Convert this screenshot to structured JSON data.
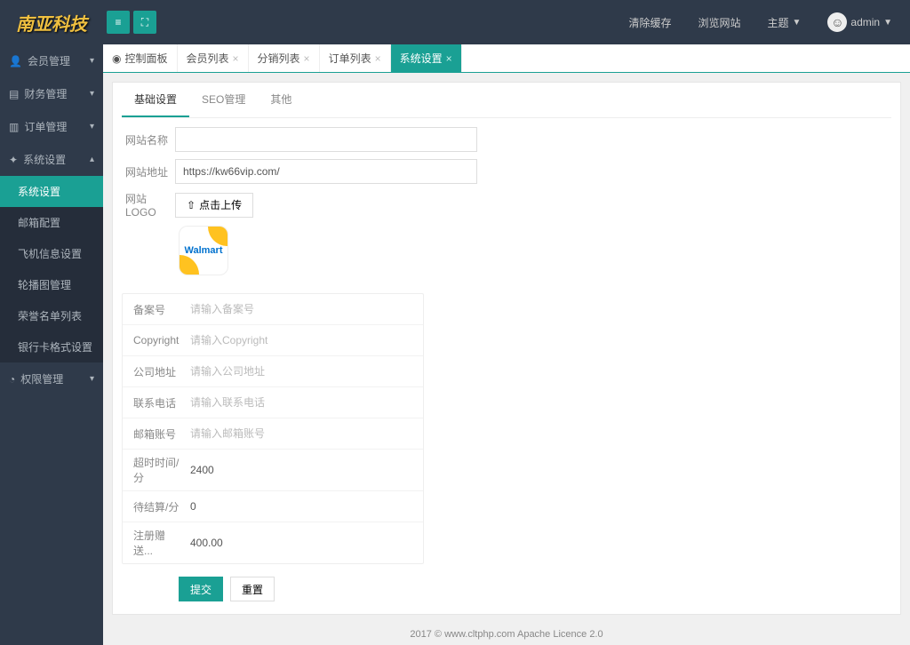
{
  "topbar": {
    "logo_text": "南亚科技",
    "clear_cache": "清除缓存",
    "view_site": "浏览网站",
    "theme": "主题",
    "username": "admin"
  },
  "sidebar": {
    "items": [
      {
        "icon": "👤",
        "label": "会员管理"
      },
      {
        "icon": "📋",
        "label": "财务管理"
      },
      {
        "icon": "📄",
        "label": "订单管理"
      },
      {
        "icon": "🔧",
        "label": "系统设置",
        "expanded": true,
        "children": [
          {
            "label": "系统设置",
            "active": true
          },
          {
            "label": "邮箱配置"
          },
          {
            "label": "飞机信息设置"
          },
          {
            "label": "轮播图管理"
          },
          {
            "label": "荣誉名单列表"
          },
          {
            "label": "银行卡格式设置"
          }
        ]
      },
      {
        "icon": "🔒",
        "label": "权限管理"
      }
    ]
  },
  "tabs": [
    {
      "label": "控制面板",
      "home": true
    },
    {
      "label": "会员列表"
    },
    {
      "label": "分销列表"
    },
    {
      "label": "订单列表"
    },
    {
      "label": "系统设置",
      "active": true
    }
  ],
  "subtabs": [
    {
      "label": "基础设置",
      "active": true
    },
    {
      "label": "SEO管理"
    },
    {
      "label": "其他"
    }
  ],
  "form": {
    "site_name_label": "网站名称",
    "site_name_value": "",
    "site_url_label": "网站地址",
    "site_url_value": "https://kw66vip.com/",
    "site_logo_label": "网站LOGO",
    "upload_btn": "点击上传",
    "logo_preview_text": "Walmart",
    "icp_label": "备案号",
    "icp_placeholder": "请输入备案号",
    "copyright_label": "Copyright",
    "copyright_placeholder": "请输入Copyright",
    "company_addr_label": "公司地址",
    "company_addr_placeholder": "请输入公司地址",
    "contact_phone_label": "联系电话",
    "contact_phone_placeholder": "请输入联系电话",
    "email_label": "邮箱账号",
    "email_placeholder": "请输入邮箱账号",
    "timeout_label": "超时时间/分",
    "timeout_value": "2400",
    "settle_label": "待结算/分",
    "settle_value": "0",
    "reg_bonus_label": "注册赠送...",
    "reg_bonus_value": "400.00",
    "submit": "提交",
    "reset": "重置"
  },
  "footer": "2017 ©   www.cltphp.com   Apache Licence 2.0"
}
